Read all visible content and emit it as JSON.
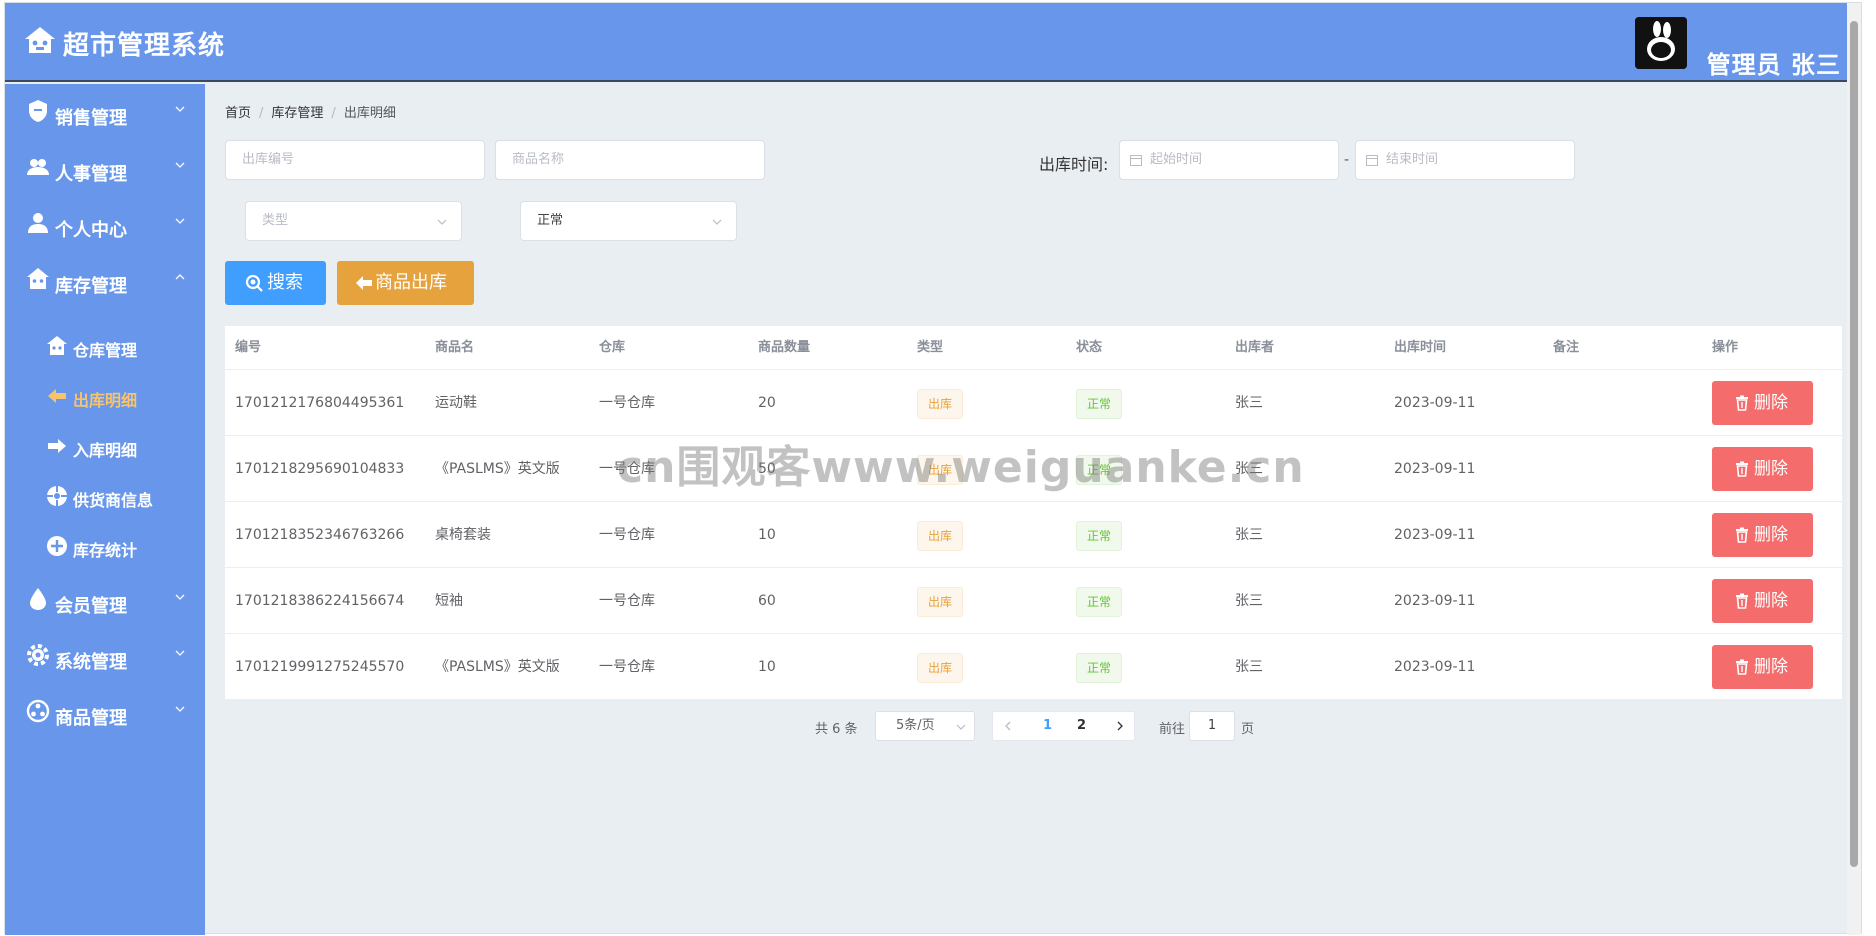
{
  "app": {
    "title": "超市管理系统",
    "admin": "管理员 张三"
  },
  "sidebar": {
    "items": [
      {
        "label": "销售管理",
        "icon": "shield-icon"
      },
      {
        "label": "人事管理",
        "icon": "users-icon"
      },
      {
        "label": "个人中心",
        "icon": "user-icon"
      },
      {
        "label": "库存管理",
        "icon": "house-icon"
      },
      {
        "label": "会员管理",
        "icon": "drop-icon"
      },
      {
        "label": "系统管理",
        "icon": "gear-icon"
      },
      {
        "label": "商品管理",
        "icon": "product-icon"
      }
    ],
    "submenu": [
      {
        "label": "仓库管理",
        "icon": "warehouse-icon"
      },
      {
        "label": "出库明细",
        "icon": "arrow-left-icon"
      },
      {
        "label": "入库明细",
        "icon": "arrow-right-icon"
      },
      {
        "label": "供货商信息",
        "icon": "supplier-icon"
      },
      {
        "label": "库存统计",
        "icon": "plus-circle-icon"
      }
    ],
    "active_sub": "出库明细",
    "accent_color": "#f7c36b"
  },
  "breadcrumb": [
    "首页",
    "库存管理",
    "出库明细"
  ],
  "filters": {
    "out_no_placeholder": "出库编号",
    "product_name_placeholder": "商品名称",
    "time_label": "出库时间:",
    "start_placeholder": "起始时间",
    "end_placeholder": "结束时间",
    "range_sep": "-",
    "type_placeholder": "类型",
    "status_value": "正常"
  },
  "buttons": {
    "search": "搜索",
    "out": "商品出库"
  },
  "table": {
    "columns": [
      "编号",
      "商品名",
      "仓库",
      "商品数量",
      "类型",
      "状态",
      "出库者",
      "出库时间",
      "备注",
      "操作"
    ],
    "rows": [
      {
        "id": "1701212176804495361",
        "name": "运动鞋",
        "warehouse": "一号仓库",
        "qty": "20",
        "type": "出库",
        "status": "正常",
        "operator": "张三",
        "time": "2023-09-11",
        "note": "",
        "action": "删除"
      },
      {
        "id": "1701218295690104833",
        "name": "《PASLMS》英文版",
        "warehouse": "一号仓库",
        "qty": "50",
        "type": "出库",
        "status": "正常",
        "operator": "张三",
        "time": "2023-09-11",
        "note": "",
        "action": "删除"
      },
      {
        "id": "1701218352346763266",
        "name": "桌椅套装",
        "warehouse": "一号仓库",
        "qty": "10",
        "type": "出库",
        "status": "正常",
        "operator": "张三",
        "time": "2023-09-11",
        "note": "",
        "action": "删除"
      },
      {
        "id": "1701218386224156674",
        "name": "短袖",
        "warehouse": "一号仓库",
        "qty": "60",
        "type": "出库",
        "status": "正常",
        "operator": "张三",
        "time": "2023-09-11",
        "note": "",
        "action": "删除"
      },
      {
        "id": "1701219991275245570",
        "name": "《PASLMS》英文版",
        "warehouse": "一号仓库",
        "qty": "10",
        "type": "出库",
        "status": "正常",
        "operator": "张三",
        "time": "2023-09-11",
        "note": "",
        "action": "删除"
      }
    ]
  },
  "pagination": {
    "total": "共 6 条",
    "page_size": "5条/页",
    "pages": [
      "1",
      "2"
    ],
    "current": "1",
    "goto_label": "前往",
    "goto_value": "1",
    "page_suffix": "页"
  },
  "watermark": "cn围观客www.weiguanke.cn",
  "colors": {
    "primary": "#6796ea",
    "search": "#409eff",
    "out": "#e6a23c",
    "danger": "#f56c6c"
  }
}
